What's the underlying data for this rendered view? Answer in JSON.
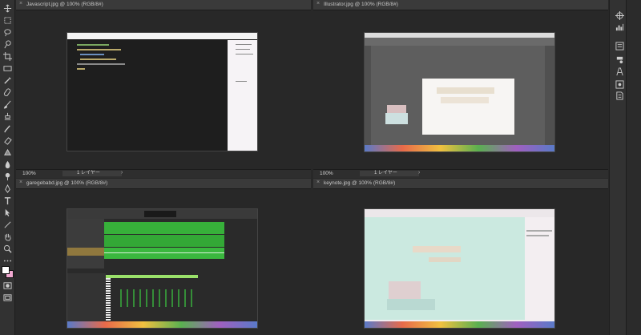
{
  "documents": [
    {
      "title": "Javascript.jpg @ 100% (RGB/8#)",
      "zoom": "100%",
      "layer": "1 レイヤー"
    },
    {
      "title": "Illustrator.jpg @ 100% (RGB/8#)",
      "zoom": "100%",
      "layer": "1 レイヤー"
    },
    {
      "title": "garegebabd.jpg @ 100% (RGB/8#)",
      "zoom": "",
      "layer": ""
    },
    {
      "title": "keynote.jpg @ 100% (RGB/8#)",
      "zoom": "",
      "layer": ""
    }
  ],
  "close_glyph": "×",
  "tools": [
    "move-icon",
    "marquee-icon",
    "lasso-icon",
    "quick-select-icon",
    "crop-icon",
    "frame-icon",
    "eyedropper-icon",
    "healing-icon",
    "brush-icon",
    "stamp-icon",
    "history-brush-icon",
    "eraser-icon",
    "gradient-icon",
    "blur-icon",
    "dodge-icon",
    "pen-icon",
    "type-icon",
    "path-select-icon",
    "shape-icon",
    "hand-icon",
    "zoom-icon",
    "more-tools-icon"
  ],
  "colors": {
    "foreground": "#ffffff",
    "background": "#f0a8d0",
    "accent": "#3a8a3a"
  }
}
